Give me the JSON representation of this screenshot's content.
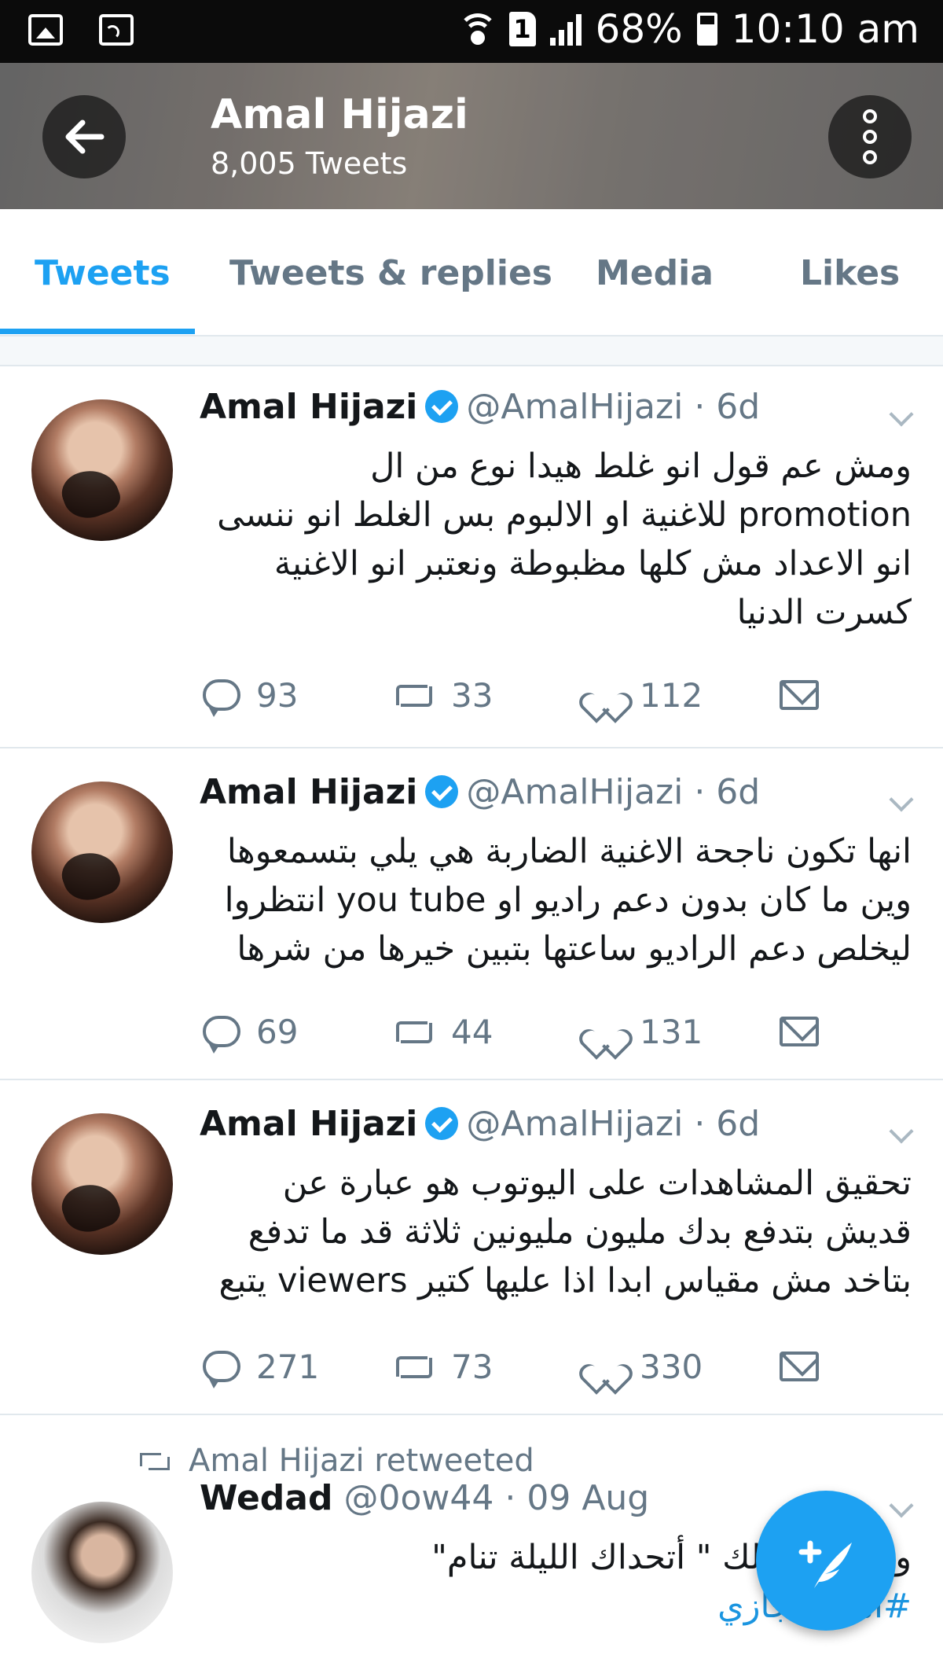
{
  "status_bar": {
    "sim": "1",
    "battery": "68%",
    "time": "10:10 am"
  },
  "header": {
    "name": "Amal Hijazi",
    "tweet_count": "8,005 Tweets"
  },
  "tabs": [
    "Tweets",
    "Tweets & replies",
    "Media",
    "Likes"
  ],
  "tweets": [
    {
      "name": "Amal Hijazi",
      "handle": "@AmalHijazi · 6d",
      "lines": [
        "ومش عم قول انو غلط هيدا نوع من ال",
        "promotion للاغنية او الالبوم بس الغلط انو ننسى",
        "انو الاعداد مش كلها مظبوطة ونعتبر انو الاغنية",
        "كسرت الدنيا"
      ],
      "replies": "93",
      "retweets": "33",
      "likes": "112"
    },
    {
      "name": "Amal Hijazi",
      "handle": "@AmalHijazi · 6d",
      "lines": [
        "انها تكون ناجحة الاغنية الضاربة هي يلي بتسمعوها",
        "وين ما كان بدون دعم راديو او you tube انتظروا",
        "ليخلص دعم الراديو ساعتها بتبين خيرها من شرها"
      ],
      "replies": "69",
      "retweets": "44",
      "likes": "131"
    },
    {
      "name": "Amal Hijazi",
      "handle": "@AmalHijazi · 6d",
      "lines": [
        "تحقيق المشاهدات على اليوتوب هو عبارة عن",
        "قديش بتدفع بدك مليون مليونين ثلاثة قد ما تدفع",
        "بتاخد مش مقياس ابدا اذا عليها كتير viewers يتبع"
      ],
      "replies": "271",
      "retweets": "73",
      "likes": "330"
    }
  ],
  "retweet": {
    "label": "Amal Hijazi retweeted",
    "name": "Wedad",
    "handle": "@0ow44 · 09 Aug",
    "line1": "و           عيني تقولك \" أتحداك الليلة تنام\"",
    "hashtag": "#امل_حجازي"
  }
}
